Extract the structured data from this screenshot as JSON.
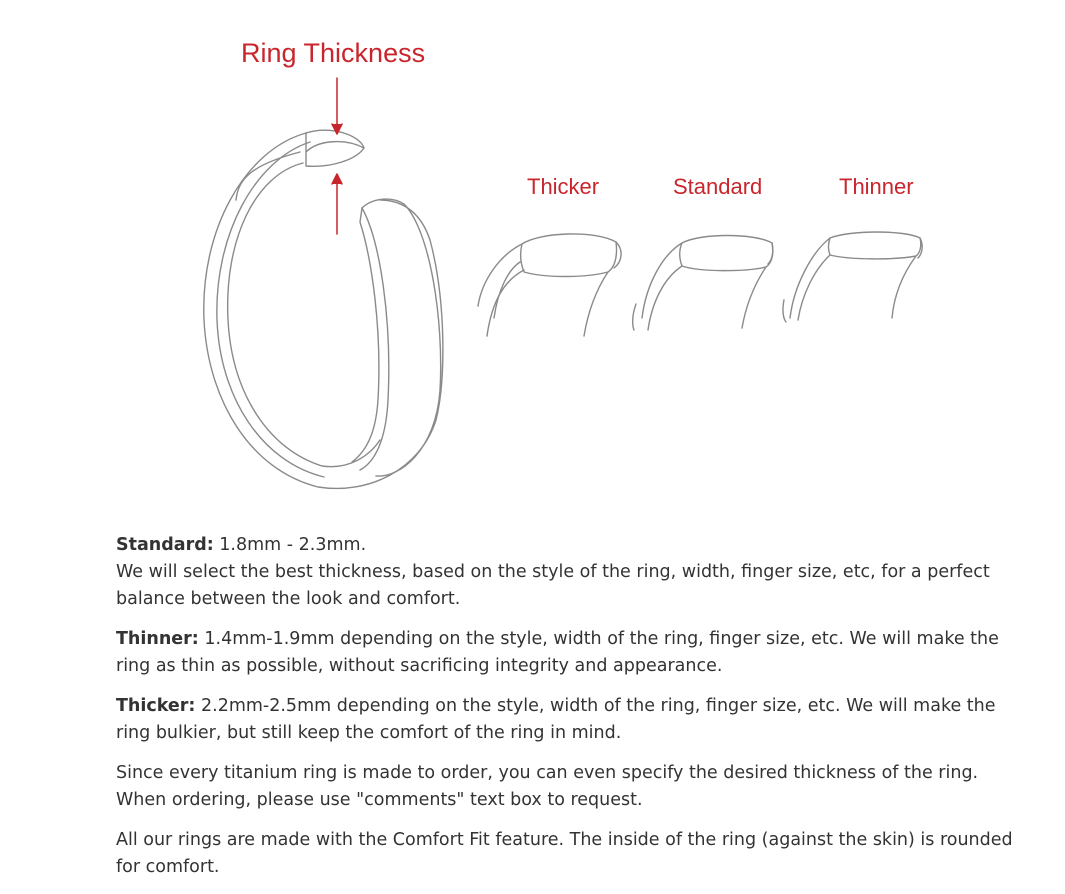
{
  "diagram": {
    "title": "Ring Thickness",
    "labels": {
      "thicker": "Thicker",
      "standard": "Standard",
      "thinner": "Thinner"
    },
    "accent_color": "#c8262c",
    "line_color": "#8a8a8a"
  },
  "paragraphs": [
    {
      "term": "Standard:",
      "text": " 1.8mm - 2.3mm.",
      "text2": "We will select the best thickness, based on the style of the ring, width, finger size, etc, for a perfect balance between the look and comfort."
    },
    {
      "term": "Thinner:",
      "text": " 1.4mm-1.9mm depending on the style, width of the ring, finger size, etc. We will make the ring as thin as possible, without sacrificing integrity and appearance."
    },
    {
      "term": "Thicker:",
      "text": " 2.2mm-2.5mm depending on the style, width of the ring, finger size, etc. We will make the ring bulkier, but still keep the comfort of the ring in mind."
    },
    {
      "text": "Since every titanium ring is made to order, you can even specify the desired thickness of the ring. When ordering, please use \"comments\" text box to request."
    },
    {
      "text": "All our rings are made with the Comfort Fit feature. The inside of the ring (against the skin) is rounded for comfort."
    }
  ]
}
